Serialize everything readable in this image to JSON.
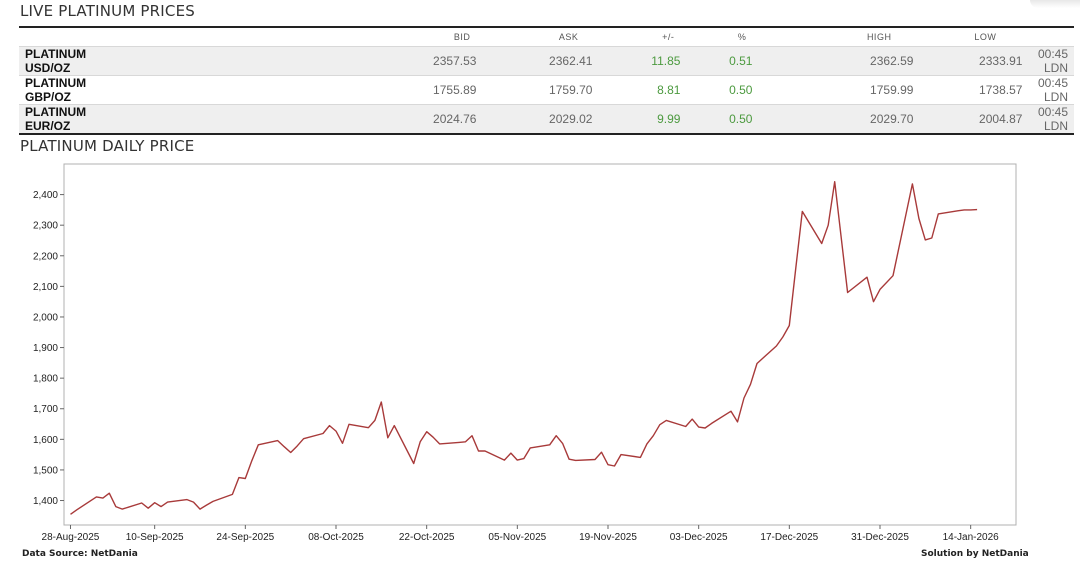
{
  "live_title": "LIVE PLATINUM PRICES",
  "chart_title": "PLATINUM DAILY PRICE",
  "table": {
    "headers": {
      "bid": "BID",
      "ask": "ASK",
      "change": "+/-",
      "percent": "%",
      "high": "HIGH",
      "low": "LOW"
    },
    "rows": [
      {
        "name": "PLATINUM USD/OZ",
        "bid": "2357.53",
        "ask": "2362.41",
        "change": "11.85",
        "percent": "0.51",
        "high": "2362.59",
        "low": "2333.91",
        "time": "00:45 LDN"
      },
      {
        "name": "PLATINUM GBP/OZ",
        "bid": "1755.89",
        "ask": "1759.70",
        "change": "8.81",
        "percent": "0.50",
        "high": "1759.99",
        "low": "1738.57",
        "time": "00:45 LDN"
      },
      {
        "name": "PLATINUM EUR/OZ",
        "bid": "2024.76",
        "ask": "2029.02",
        "change": "9.99",
        "percent": "0.50",
        "high": "2029.70",
        "low": "2004.87",
        "time": "00:45 LDN"
      }
    ]
  },
  "footer": {
    "data_source": "Data Source: NetDania",
    "solution": "Solution by NetDania"
  },
  "colors": {
    "line": "#a83a3a",
    "positive": "#4c9a3f"
  },
  "chart_data": {
    "type": "line",
    "title": "",
    "xlabel": "",
    "ylabel": "",
    "ylim": [
      1320,
      2500
    ],
    "xlim": [
      "2025-08-27",
      "2026-01-21"
    ],
    "yticks": [
      1400,
      1500,
      1600,
      1700,
      1800,
      1900,
      2000,
      2100,
      2200,
      2300,
      2400
    ],
    "yticklabels": [
      "1,400",
      "1,500",
      "1,600",
      "1,700",
      "1,800",
      "1,900",
      "2,000",
      "2,100",
      "2,200",
      "2,300",
      "2,400"
    ],
    "xticks": [
      "2025-08-28",
      "2025-09-10",
      "2025-09-24",
      "2025-10-08",
      "2025-10-22",
      "2025-11-05",
      "2025-11-19",
      "2025-12-03",
      "2025-12-17",
      "2025-12-31",
      "2026-01-14"
    ],
    "xticklabels": [
      "28-Aug-2025",
      "10-Sep-2025",
      "24-Sep-2025",
      "08-Oct-2025",
      "22-Oct-2025",
      "05-Nov-2025",
      "19-Nov-2025",
      "03-Dec-2025",
      "17-Dec-2025",
      "31-Dec-2025",
      "14-Jan-2026"
    ],
    "grid": false,
    "series": [
      {
        "x": [
          "2025-08-28",
          "2025-08-29",
          "2025-09-01",
          "2025-09-02",
          "2025-09-03",
          "2025-09-04",
          "2025-09-05",
          "2025-09-08",
          "2025-09-09",
          "2025-09-10",
          "2025-09-11",
          "2025-09-12",
          "2025-09-15",
          "2025-09-16",
          "2025-09-17",
          "2025-09-18",
          "2025-09-19",
          "2025-09-22",
          "2025-09-23",
          "2025-09-24",
          "2025-09-25",
          "2025-09-26",
          "2025-09-29",
          "2025-09-30",
          "2025-10-01",
          "2025-10-02",
          "2025-10-03",
          "2025-10-06",
          "2025-10-07",
          "2025-10-08",
          "2025-10-09",
          "2025-10-10",
          "2025-10-13",
          "2025-10-14",
          "2025-10-15",
          "2025-10-16",
          "2025-10-17",
          "2025-10-20",
          "2025-10-21",
          "2025-10-22",
          "2025-10-23",
          "2025-10-24",
          "2025-10-27",
          "2025-10-28",
          "2025-10-29",
          "2025-10-30",
          "2025-10-31",
          "2025-11-03",
          "2025-11-04",
          "2025-11-05",
          "2025-11-06",
          "2025-11-07",
          "2025-11-10",
          "2025-11-11",
          "2025-11-12",
          "2025-11-13",
          "2025-11-14",
          "2025-11-17",
          "2025-11-18",
          "2025-11-19",
          "2025-11-20",
          "2025-11-21",
          "2025-11-24",
          "2025-11-25",
          "2025-11-26",
          "2025-11-27",
          "2025-11-28",
          "2025-12-01",
          "2025-12-02",
          "2025-12-03",
          "2025-12-04",
          "2025-12-05",
          "2025-12-08",
          "2025-12-09",
          "2025-12-10",
          "2025-12-11",
          "2025-12-12",
          "2025-12-15",
          "2025-12-16",
          "2025-12-17",
          "2025-12-18",
          "2025-12-19",
          "2025-12-22",
          "2025-12-23",
          "2025-12-24",
          "2025-12-26",
          "2025-12-29",
          "2025-12-30",
          "2025-12-31",
          "2026-01-02",
          "2026-01-05",
          "2026-01-06",
          "2026-01-07",
          "2026-01-08",
          "2026-01-09",
          "2026-01-12",
          "2026-01-13",
          "2026-01-14",
          "2026-01-15"
        ],
        "values": [
          1355,
          1370,
          1412,
          1408,
          1424,
          1380,
          1372,
          1392,
          1375,
          1393,
          1380,
          1395,
          1403,
          1395,
          1372,
          1385,
          1397,
          1420,
          1475,
          1472,
          1530,
          1582,
          1596,
          1576,
          1557,
          1578,
          1602,
          1619,
          1645,
          1627,
          1587,
          1649,
          1638,
          1662,
          1722,
          1605,
          1645,
          1521,
          1592,
          1625,
          1607,
          1585,
          1590,
          1592,
          1612,
          1562,
          1562,
          1532,
          1555,
          1532,
          1537,
          1572,
          1582,
          1612,
          1586,
          1535,
          1531,
          1534,
          1558,
          1517,
          1513,
          1550,
          1541,
          1585,
          1612,
          1648,
          1662,
          1642,
          1666,
          1640,
          1637,
          1652,
          1692,
          1657,
          1735,
          1780,
          1848,
          1905,
          1935,
          1972,
          2160,
          2345,
          2240,
          2300,
          2442,
          2080,
          2130,
          2050,
          2090,
          2135,
          2435,
          2322,
          2252,
          2258,
          2337,
          2347,
          2350,
          2350,
          2351
        ]
      }
    ]
  }
}
